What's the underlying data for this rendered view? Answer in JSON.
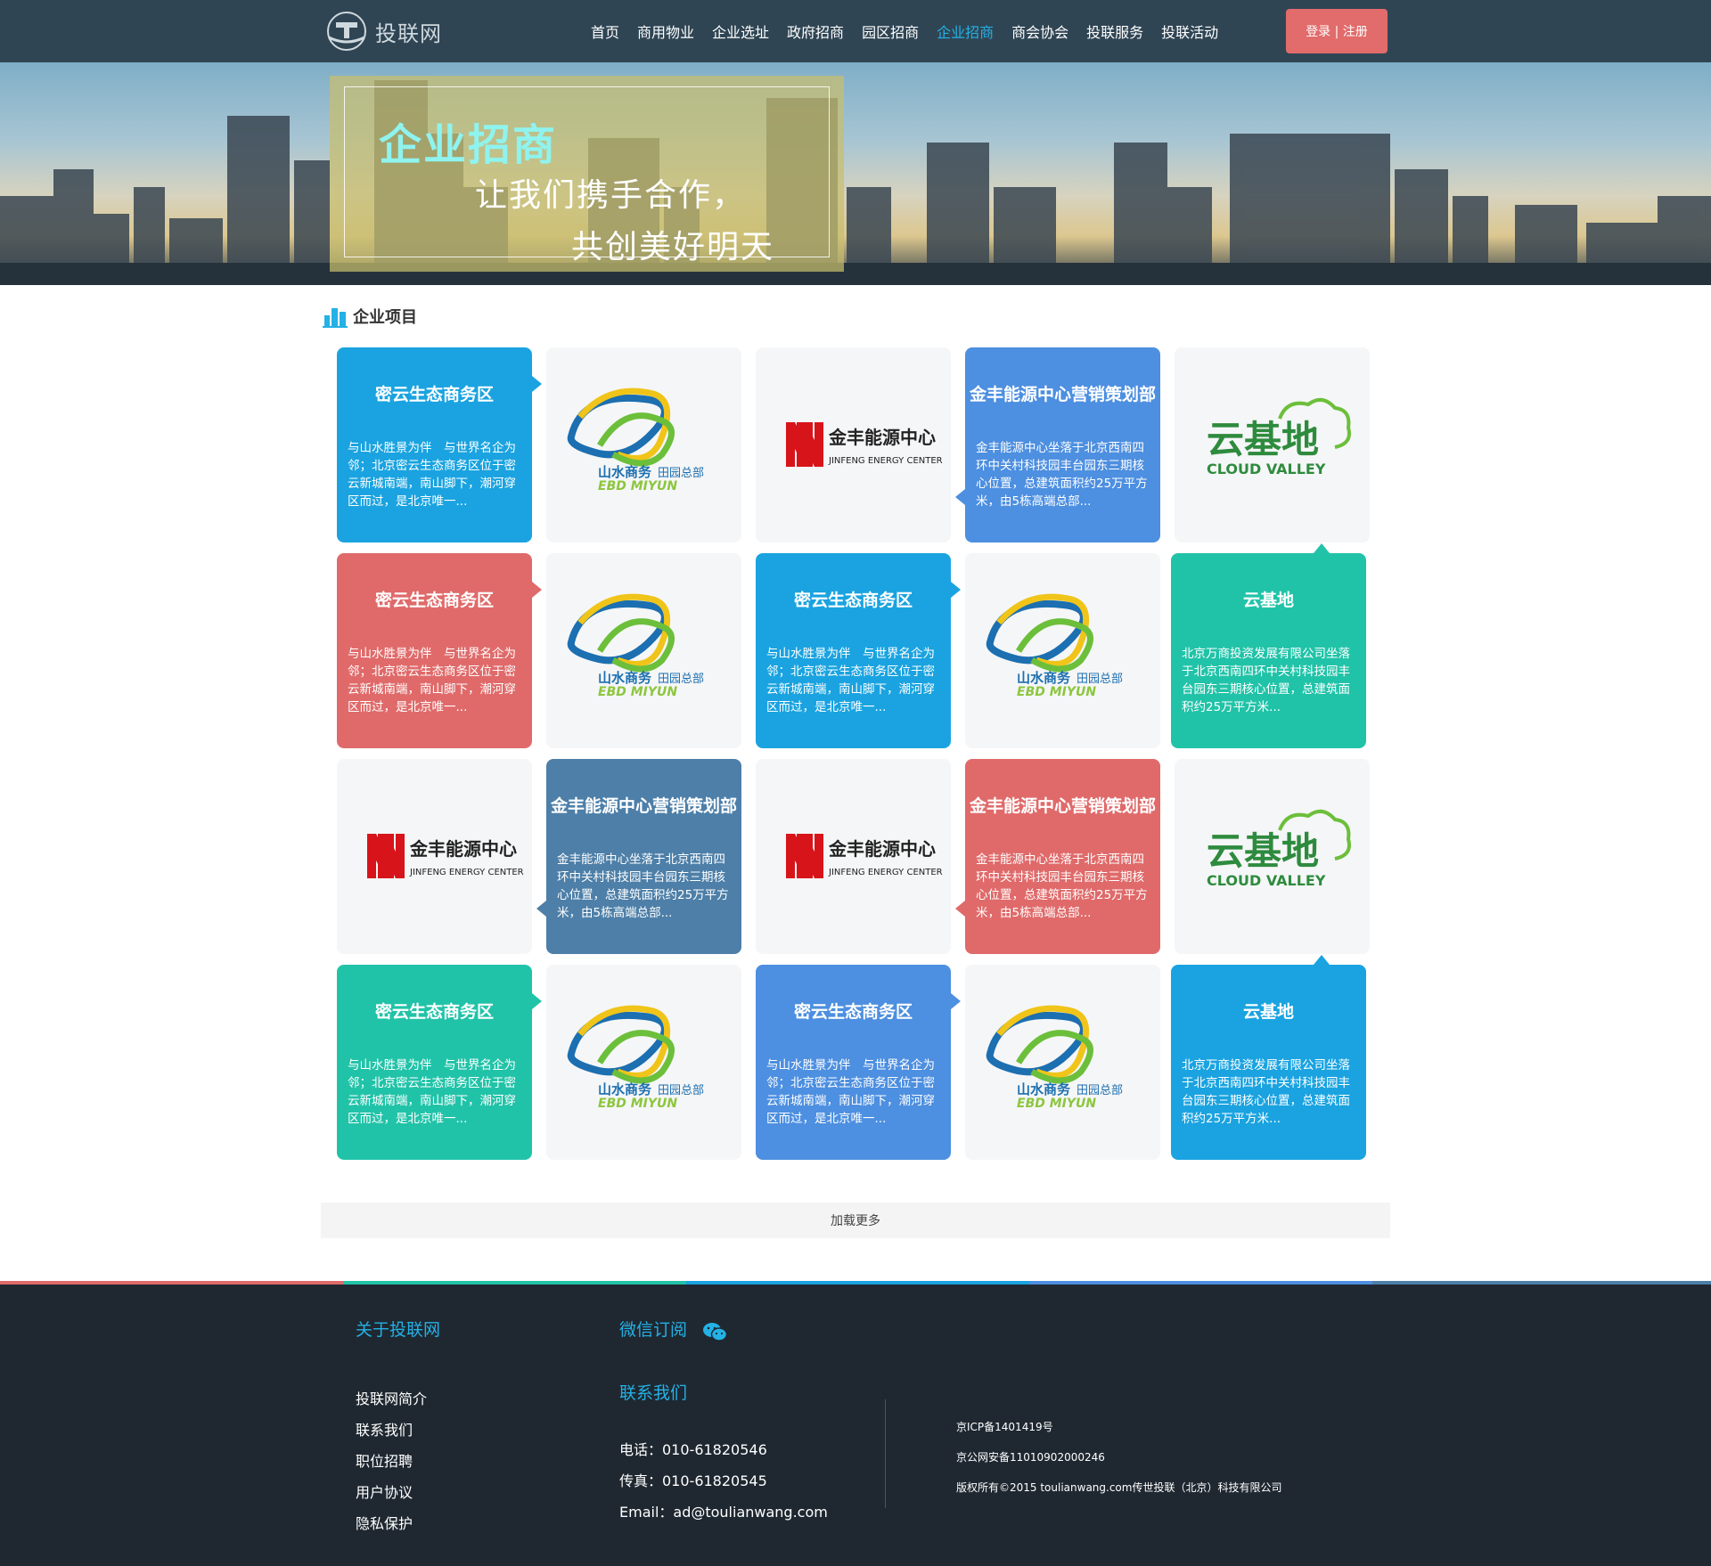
{
  "header": {
    "logo_text": "投联网",
    "nav": [
      "首页",
      "商用物业",
      "企业选址",
      "政府招商",
      "园区招商",
      "企业招商",
      "商会协会",
      "投联服务",
      "投联活动"
    ],
    "active_index": 5,
    "login_label": "登录 | 注册"
  },
  "banner": {
    "title": "企业招商",
    "subtitle_line1": "让我们携手合作，",
    "subtitle_line2": "共创美好明天"
  },
  "section": {
    "title": "企业项目",
    "load_more": "加载更多"
  },
  "projects": {
    "miyun_title": "密云生态商务区",
    "miyun_desc": "与山水胜景为伴　与世界名企为邻；北京密云生态商务区位于密云新城南端，南山脚下，潮河穿区而过，是北京唯一...",
    "jinfeng_title": "金丰能源中心营销策划部",
    "jinfeng_desc": "金丰能源中心坐落于北京西南四环中关村科技园丰台园东三期核心位置，总建筑面积约25万平方米，由5栋高端总部...",
    "yunjidi_title": "云基地",
    "yunjidi_desc": "北京万商投资发展有限公司坐落于北京西南四环中关村科技园丰台园东三期核心位置，总建筑面积约25万平方米..."
  },
  "logos": {
    "miyun_cn": "山水商务",
    "miyun_cn2": "田园总部",
    "miyun_en": "EBD MIYUN",
    "jinfeng_cn": "金丰能源中心",
    "jinfeng_en": "JINFENG ENERGY CENTER",
    "cloud_cn": "云基地",
    "cloud_en": "CLOUD VALLEY"
  },
  "colors": {
    "blue": "#1aa3e0",
    "red": "#e06a6a",
    "teal": "#21c3a8",
    "royal": "#4d8fe0",
    "slate": "#4d7fa8",
    "nav_bg": "#2f4554",
    "footer_bg": "#1f2831",
    "accent": "#24b1e6"
  },
  "footer": {
    "about_heading": "关于投联网",
    "about_links": [
      "投联网简介",
      "联系我们",
      "职位招聘",
      "用户协议",
      "隐私保护"
    ],
    "wechat_heading": "微信订阅",
    "contact_heading": "联系我们",
    "phone": "电话：010-61820546",
    "fax": "传真：010-61820545",
    "email": "Email：ad@toulianwang.com",
    "icp": "京ICP备1401419号",
    "police": "京公网安备11010902000246",
    "copyright": "版权所有©2015 toulianwang.com传世投联（北京）科技有限公司"
  }
}
